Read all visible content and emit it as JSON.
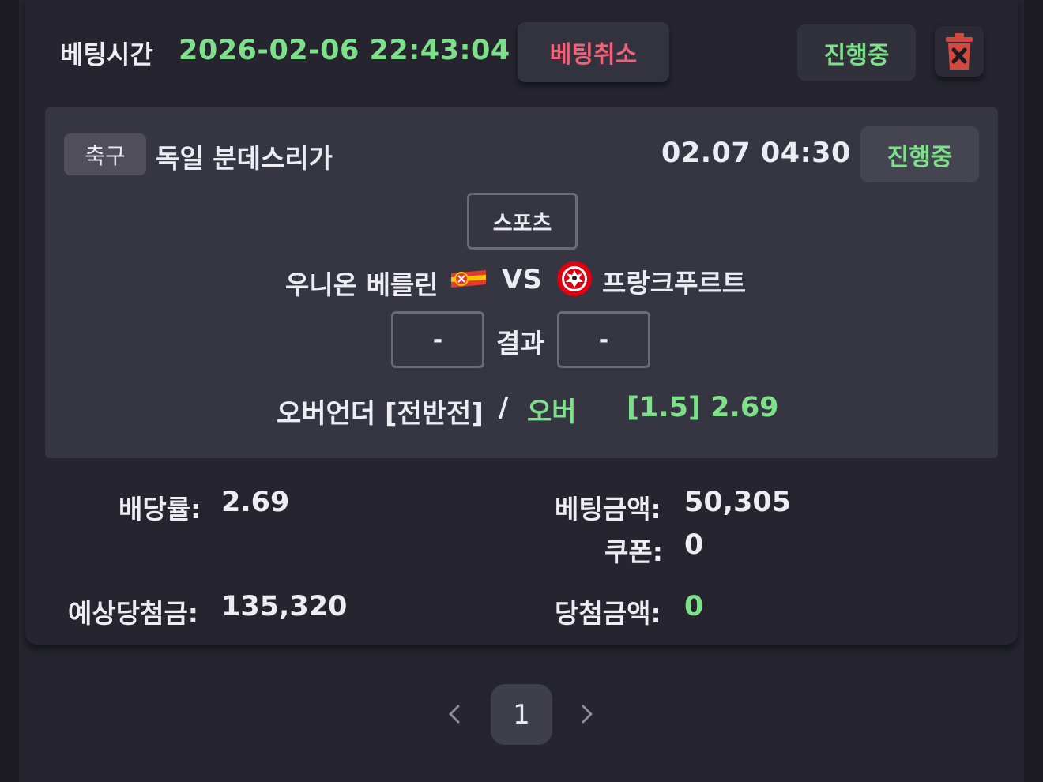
{
  "header": {
    "label": "베팅시간",
    "bet_time": "2026-02-06 22:43:04",
    "cancel_label": "베팅취소",
    "status_label": "진행중"
  },
  "match": {
    "sport": "축구",
    "league": "독일 분데스리가",
    "kickoff": "02.07 04:30",
    "status": "진행중",
    "category": "스포츠",
    "home_team": "우니온 베를린",
    "vs": "VS",
    "away_team": "프랑크푸르트",
    "home_score": "-",
    "result_label": "결과",
    "away_score": "-",
    "market": "오버언더 [전반전]",
    "separator": "/",
    "pick": "오버",
    "line_odds": "[1.5] 2.69"
  },
  "summary": {
    "odds_label": "배당률:",
    "odds_value": "2.69",
    "bet_amount_label": "베팅금액:",
    "bet_amount_value": "50,305",
    "coupon_label": "쿠폰:",
    "coupon_value": "0",
    "expected_label": "예상당첨금:",
    "expected_value": "135,320",
    "win_amount_label": "당첨금액:",
    "win_amount_value": "0"
  },
  "pagination": {
    "current_page": "1"
  },
  "colors": {
    "accent_green": "#7ee08a",
    "cancel_red": "#f0627a",
    "delete_red": "#d24a3e"
  }
}
